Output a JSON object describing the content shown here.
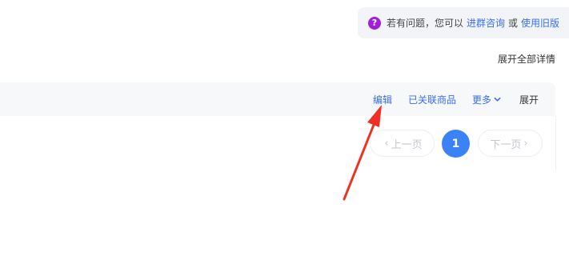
{
  "help_banner": {
    "icon": "question-circle-icon",
    "icon_glyph": "?",
    "icon_color": "#a020d8",
    "text_before": "若有问题，您可以",
    "link_consult": "进群咨询",
    "text_or": "或",
    "link_old_version": "使用旧版"
  },
  "expand_all_label": "展开全部详情",
  "card_actions": {
    "edit": "编辑",
    "linked_products": "已关联商品",
    "more": "更多",
    "more_icon": "chevron-down-icon",
    "expand": "展开"
  },
  "pagination": {
    "prev_label": "上一页",
    "prev_icon": "‹",
    "next_label": "下一页",
    "next_icon": "›",
    "current_page": "1",
    "active_color": "#3b82f6"
  },
  "annotation": {
    "arrow_color": "#ee3124"
  }
}
